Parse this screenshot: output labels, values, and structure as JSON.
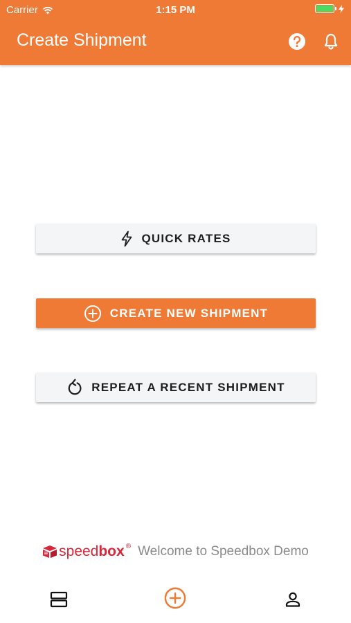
{
  "status_bar": {
    "carrier": "Carrier",
    "time": "1:15 PM"
  },
  "header": {
    "title": "Create Shipment",
    "icons": [
      "help-icon",
      "bell-icon"
    ]
  },
  "actions": {
    "quick_rates": "QUICK RATES",
    "create_new": "CREATE NEW SHIPMENT",
    "repeat_recent": "REPEAT A RECENT SHIPMENT"
  },
  "footer": {
    "brand_light": "speed",
    "brand_bold": "box",
    "registered": "®",
    "welcome": "Welcome to Speedbox Demo"
  },
  "tabbar": {
    "icons": [
      "list-icon",
      "add-circle-icon",
      "profile-icon"
    ]
  },
  "colors": {
    "accent": "#ef7a35",
    "brand_red": "#d8263a",
    "button_light": "#f4f5f7",
    "battery_green": "#4cd964"
  }
}
